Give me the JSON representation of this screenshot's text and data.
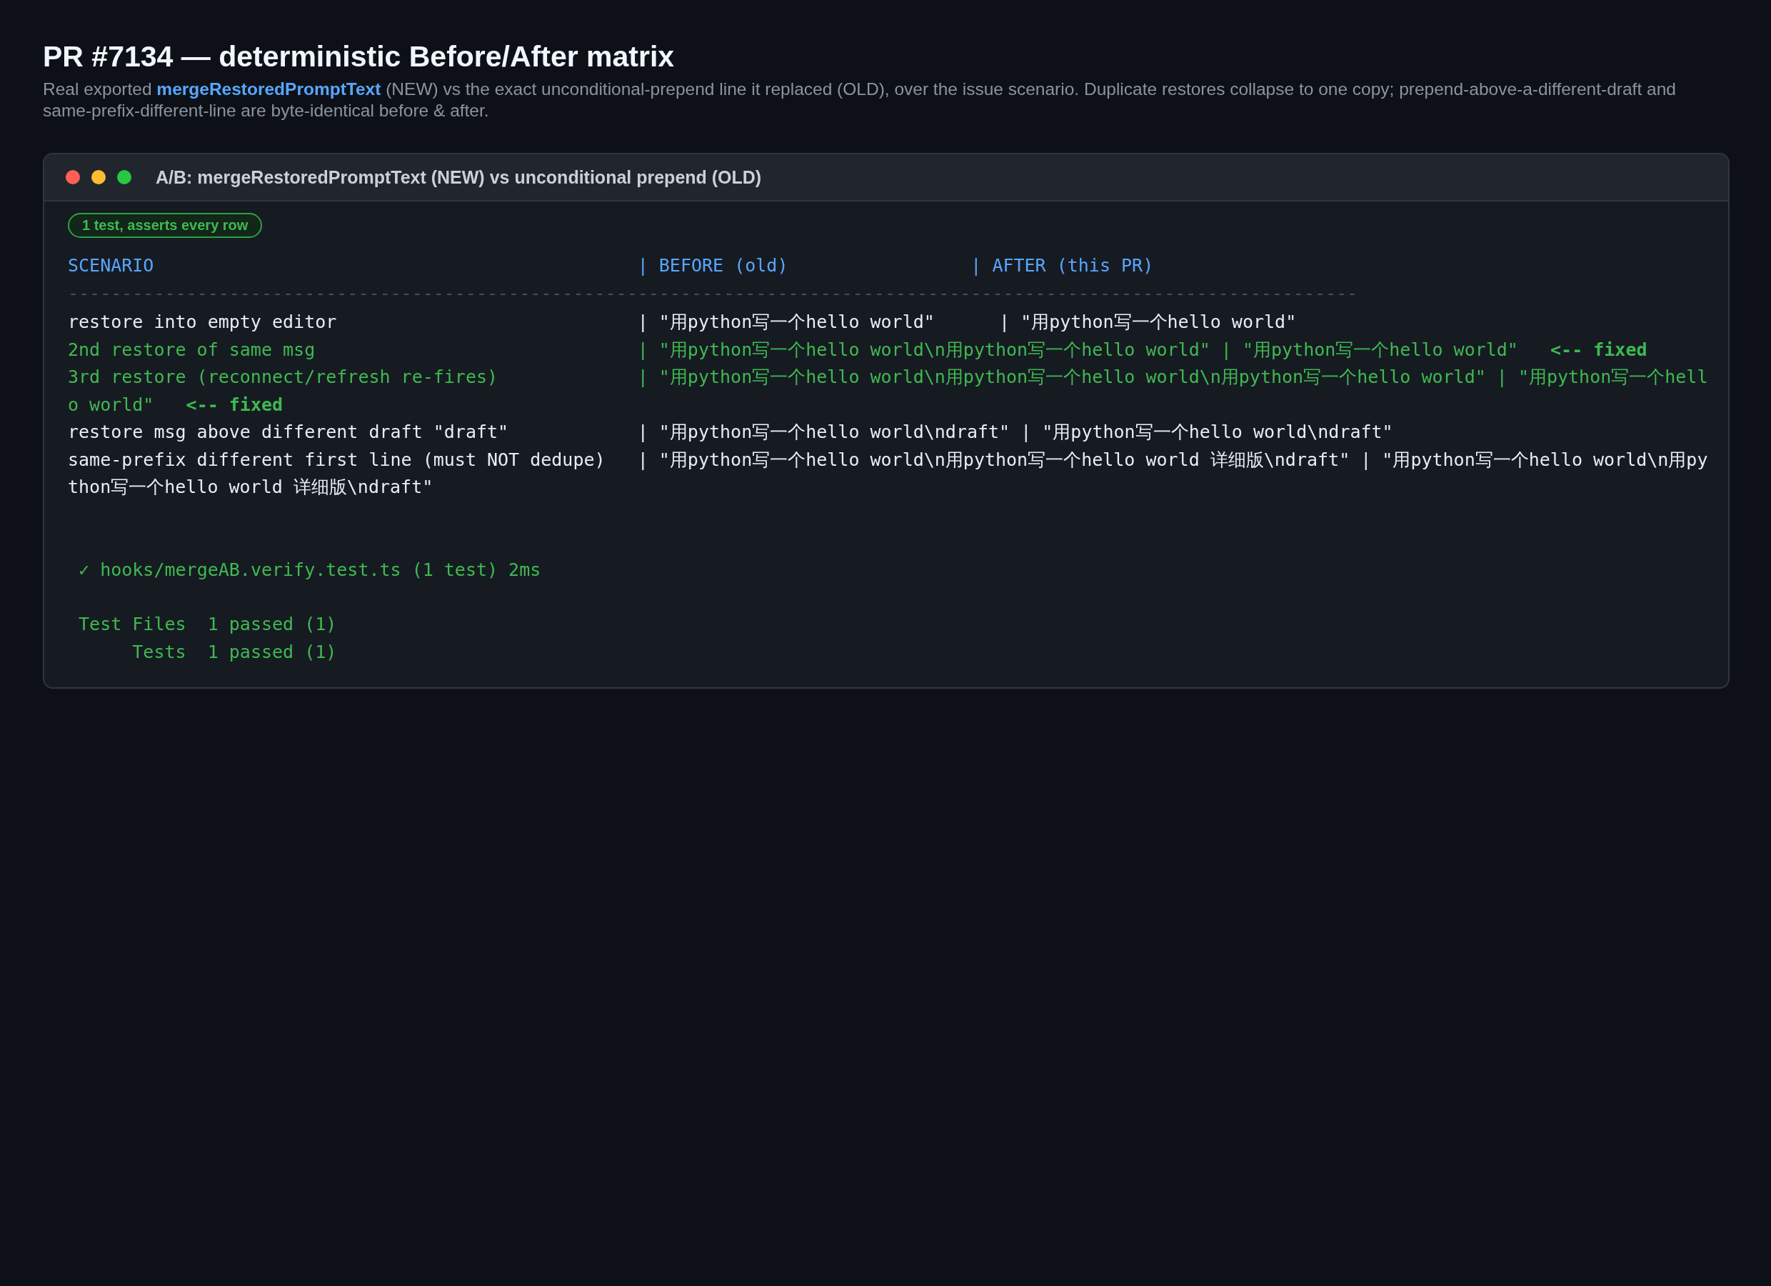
{
  "page": {
    "title": "PR #7134 — deterministic Before/After matrix",
    "subtitle": "Real exported **mergeRestoredPromptText** (NEW) vs the exact unconditional-prepend line it replaced (OLD), over the issue scenario. Duplicate restores collapse to one copy; prepend-above-a-different-draft and same-prefix-different-line are byte-identical before & after."
  },
  "window": {
    "title": "A/B: mergeRestoredPromptText (NEW) vs unconditional prepend (OLD)",
    "badge": "1 test, asserts every row"
  },
  "terminal": {
    "header": "SCENARIO                                             | BEFORE (old)                 | AFTER (this PR)",
    "rule": "------------------------------------------------------------------------------------------------------------------------",
    "rows": [
      {
        "kind": "unchanged",
        "text": "restore into empty editor                            | \"用python写一个hello world\"      | \"用python写一个hello world\""
      },
      {
        "kind": "fixed",
        "text": "2nd restore of same msg                              | \"用python写一个hello world\\n用python写一个hello world\" | \"用python写一个hello world\"",
        "marker": "<-- fixed"
      },
      {
        "kind": "fixed",
        "text": "3rd restore (reconnect/refresh re-fires)             | \"用python写一个hello world\\n用python写一个hello world\\n用python写一个hello world\" | \"用python写一个hello world\"",
        "marker": "<-- fixed"
      },
      {
        "kind": "unchanged",
        "text": "restore msg above different draft \"draft\"            | \"用python写一个hello world\\ndraft\" | \"用python写一个hello world\\ndraft\""
      },
      {
        "kind": "unchanged",
        "text": "same-prefix different first line (must NOT dedupe)   | \"用python写一个hello world\\n用python写一个hello world 详细版\\ndraft\" | \"用python写一个hello world\\n用python写一个hello world 详细版\\ndraft\""
      }
    ],
    "result": " ✓ hooks/mergeAB.verify.test.ts (1 test) 2ms",
    "totals": [
      " Test Files  1 passed (1)",
      "      Tests  1 passed (1)"
    ]
  }
}
